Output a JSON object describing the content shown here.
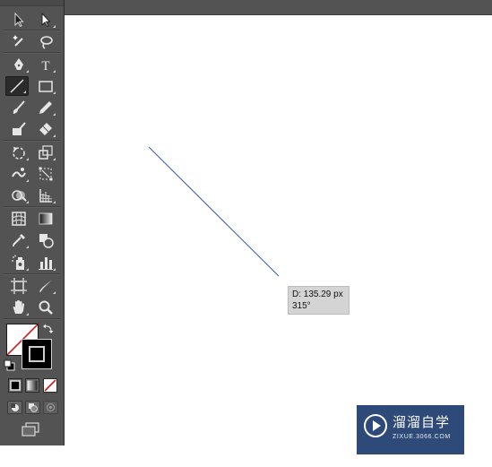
{
  "tooltip": {
    "distance": "D: 135.29 px",
    "angle": "315°"
  },
  "watermark": {
    "title": "溜溜自学",
    "subtitle": "ZIXUE.3066.COM"
  },
  "toolbar": {
    "tools": [
      {
        "name": "selection-tool",
        "icon": "arrow-icon"
      },
      {
        "name": "direct-selection-tool",
        "icon": "hollow-arrow-icon"
      },
      {
        "name": "magic-wand-tool",
        "icon": "magic-wand-icon"
      },
      {
        "name": "lasso-tool",
        "icon": "lasso-icon"
      },
      {
        "name": "pen-tool",
        "icon": "pen-icon"
      },
      {
        "name": "type-tool",
        "icon": "type-icon",
        "label": "T"
      },
      {
        "name": "line-segment-tool",
        "icon": "line-icon",
        "active": true
      },
      {
        "name": "rectangle-tool",
        "icon": "rectangle-icon"
      },
      {
        "name": "paintbrush-tool",
        "icon": "paintbrush-icon"
      },
      {
        "name": "pencil-tool",
        "icon": "pencil-icon"
      },
      {
        "name": "blob-brush-tool",
        "icon": "blob-brush-icon"
      },
      {
        "name": "eraser-tool",
        "icon": "eraser-icon"
      },
      {
        "name": "rotate-tool",
        "icon": "rotate-icon"
      },
      {
        "name": "scale-tool",
        "icon": "scale-icon"
      },
      {
        "name": "warp-tool",
        "icon": "warp-icon"
      },
      {
        "name": "free-transform-tool",
        "icon": "free-transform-icon"
      },
      {
        "name": "shape-builder-tool",
        "icon": "shape-builder-icon"
      },
      {
        "name": "perspective-grid-tool",
        "icon": "perspective-grid-icon"
      },
      {
        "name": "mesh-tool",
        "icon": "mesh-icon"
      },
      {
        "name": "gradient-tool",
        "icon": "gradient-icon"
      },
      {
        "name": "eyedropper-tool",
        "icon": "eyedropper-icon"
      },
      {
        "name": "blend-tool",
        "icon": "blend-icon"
      },
      {
        "name": "symbol-sprayer-tool",
        "icon": "symbol-sprayer-icon"
      },
      {
        "name": "column-graph-tool",
        "icon": "column-graph-icon"
      },
      {
        "name": "artboard-tool",
        "icon": "artboard-icon"
      },
      {
        "name": "slice-tool",
        "icon": "slice-icon"
      },
      {
        "name": "hand-tool",
        "icon": "hand-icon"
      },
      {
        "name": "zoom-tool",
        "icon": "zoom-icon"
      }
    ]
  },
  "colors": {
    "toolbar_bg": "#535353",
    "line_stroke": "#3b5ba8",
    "watermark_bg": "#2d4a78",
    "none_red": "#d01818"
  }
}
